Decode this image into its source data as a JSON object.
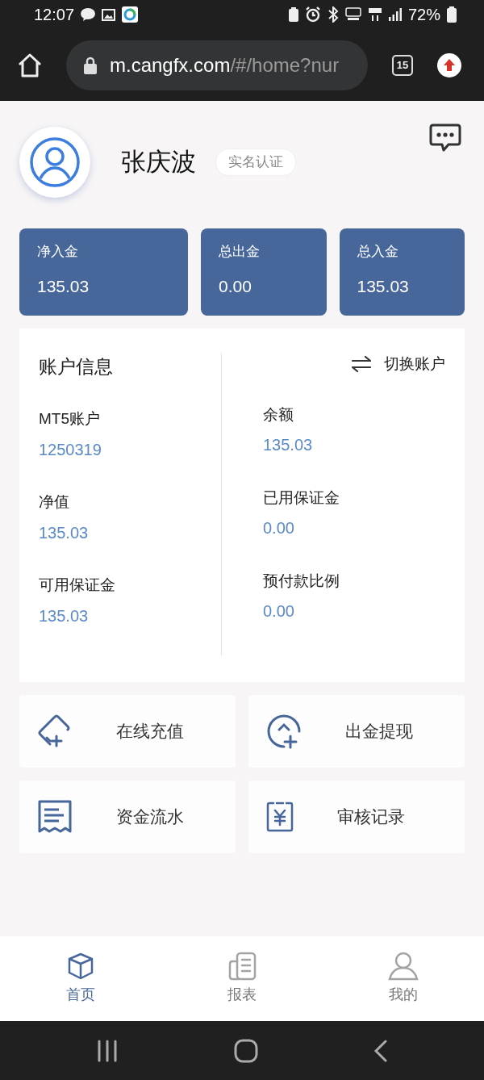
{
  "status_bar": {
    "time": "12:07",
    "battery": "72%"
  },
  "browser": {
    "url": {
      "host": "m.cangfx.com",
      "path": "/#/home?nur"
    },
    "tab_count": "15"
  },
  "profile": {
    "name": "张庆波",
    "badge": "实名认证"
  },
  "stats": [
    {
      "label": "净入金",
      "value": "135.03"
    },
    {
      "label": "总出金",
      "value": "0.00"
    },
    {
      "label": "总入金",
      "value": "135.03"
    }
  ],
  "account": {
    "title": "账户信息",
    "switch_label": "切换账户",
    "fields": [
      {
        "label": "MT5账户",
        "value": "1250319"
      },
      {
        "label": "余额",
        "value": "135.03"
      },
      {
        "label": "净值",
        "value": "135.03"
      },
      {
        "label": "已用保证金",
        "value": "0.00"
      },
      {
        "label": "可用保证金",
        "value": "135.03"
      },
      {
        "label": "预付款比例",
        "value": "0.00"
      }
    ]
  },
  "actions": [
    {
      "kind": "deposit",
      "label": "在线充值"
    },
    {
      "kind": "withdraw",
      "label": "出金提现"
    },
    {
      "kind": "ledger",
      "label": "资金流水"
    },
    {
      "kind": "audit",
      "label": "审核记录"
    }
  ],
  "bottom_nav": [
    {
      "kind": "home",
      "label": "首页",
      "selected": true
    },
    {
      "kind": "report",
      "label": "报表",
      "selected": false
    },
    {
      "kind": "me",
      "label": "我的",
      "selected": false
    }
  ]
}
